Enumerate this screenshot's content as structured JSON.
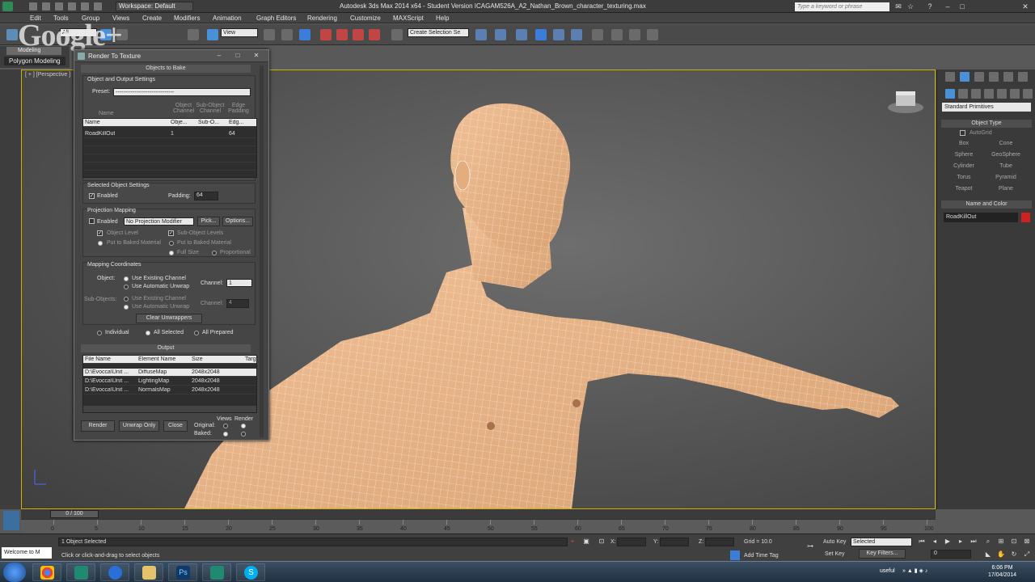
{
  "titlebar": {
    "workspace": "Workspace: Default",
    "title": "Autodesk 3ds Max  2014 x64   - Student Version    ICAGAM526A_A2_Nathan_Brown_character_texturing.max",
    "search_placeholder": "Type a keyword or phrase"
  },
  "menu": [
    "Edit",
    "Tools",
    "Group",
    "Views",
    "Create",
    "Modifiers",
    "Animation",
    "Graph Editors",
    "Rendering",
    "Customize",
    "MAXScript",
    "Help"
  ],
  "toolbar": {
    "selection_filter": "All",
    "ref_coord": "View",
    "named_selection": "Create Selection Se",
    "watermark": "Google+"
  },
  "ribbon": {
    "tab": "Modeling",
    "panel": "Polygon Modeling"
  },
  "viewport": {
    "label": "[ + ] [Perspective ]"
  },
  "dialog": {
    "title": "Render To Texture",
    "objects_to_bake": "Objects to Bake",
    "object_output_settings": "Object and Output Settings",
    "preset_label": "Preset:",
    "preset_value": "-------------------------------",
    "col_name": "Name",
    "col_object_channel": "Object Channel",
    "col_subobject_channel": "Sub-Object Channel",
    "col_edge_padding": "Edge Padding",
    "table_header": [
      "Name",
      "Obje...",
      "Sub-O...",
      "Edg..."
    ],
    "table_rows": [
      [
        "RoadKillOut",
        "1",
        "",
        "64"
      ]
    ],
    "selected_object_settings": "Selected Object Settings",
    "enabled": "Enabled",
    "padding_label": "Padding:",
    "padding_value": "64",
    "projection_mapping": "Projection Mapping",
    "proj_enabled": "Enabled",
    "no_projection_modifier": "No Projection Modifier",
    "pick": "Pick...",
    "options": "Options...",
    "object_level": "Object Level",
    "sub_object_levels": "Sub-Object Levels",
    "put_to_baked_1": "Put to Baked Material",
    "put_to_baked_2": "Put to Baked Material",
    "full_size": "Full Size",
    "proportional": "Proportional",
    "mapping_coordinates": "Mapping Coordinates",
    "object_label": "Object:",
    "use_existing_channel": "Use Existing Channel",
    "use_automatic_unwrap": "Use Automatic Unwrap",
    "channel_label": "Channel:",
    "channel_value": "1",
    "subobjects_label": "Sub-Objects:",
    "sub_use_existing": "Use Existing Channel",
    "sub_use_auto": "Use Automatic Unwrap",
    "sub_channel_label": "Channel:",
    "sub_channel_value": "4",
    "clear_unwrappers": "Clear Unwrappers",
    "individual": "Individual",
    "all_selected": "All Selected",
    "all_prepared": "All Prepared",
    "output": "Output",
    "output_header": [
      "File Name",
      "Element Name",
      "Size",
      "Targ"
    ],
    "output_rows": [
      [
        "D:\\Evocca\\Unit ...",
        "DiffuseMap",
        "2048x2048"
      ],
      [
        "D:\\Evocca\\Unit ...",
        "LightingMap",
        "2048x2048"
      ],
      [
        "D:\\Evocca\\Unit ...",
        "NormalsMap",
        "2048x2048"
      ]
    ],
    "render_btn": "Render",
    "unwrap_only_btn": "Unwrap Only",
    "close_btn": "Close",
    "original_label": "Original:",
    "baked_label": "Baked:",
    "views_label": "Views",
    "render_label": "Render"
  },
  "right_panel": {
    "primitive_dropdown": "Standard Primitives",
    "object_type": "Object Type",
    "autogrid": "AutoGrid",
    "primitives": [
      "Box",
      "Cone",
      "Sphere",
      "GeoSphere",
      "Cylinder",
      "Tube",
      "Torus",
      "Pyramid",
      "Teapot",
      "Plane"
    ],
    "name_and_color": "Name and Color",
    "object_name": "RoadKillOut",
    "object_color": "#d02020"
  },
  "timeline": {
    "frame_indicator": "0 / 100",
    "ticks": [
      "0",
      "5",
      "10",
      "15",
      "20",
      "25",
      "30",
      "35",
      "40",
      "45",
      "50",
      "55",
      "60",
      "65",
      "70",
      "75",
      "80",
      "85",
      "90",
      "95",
      "100"
    ]
  },
  "status": {
    "maxscript_text": "Welcome to M",
    "selection_info": "1 Object Selected",
    "prompt": "Click or click-and-drag to select objects",
    "x_label": "X:",
    "y_label": "Y:",
    "z_label": "Z:",
    "grid": "Grid = 10.0",
    "add_time_tag": "Add Time Tag",
    "auto_key": "Auto Key",
    "set_key": "Set Key",
    "key_mode": "Selected",
    "key_filters": "Key Filters...",
    "current_frame": "0",
    "tray_text": "useful"
  },
  "taskbar": {
    "time": "6:06 PM",
    "date": "17/04/2014"
  },
  "colors": {
    "viewport_border": "#c8b400",
    "mesh_skin": "#e8b487",
    "mesh_wire": "#ffffff"
  }
}
